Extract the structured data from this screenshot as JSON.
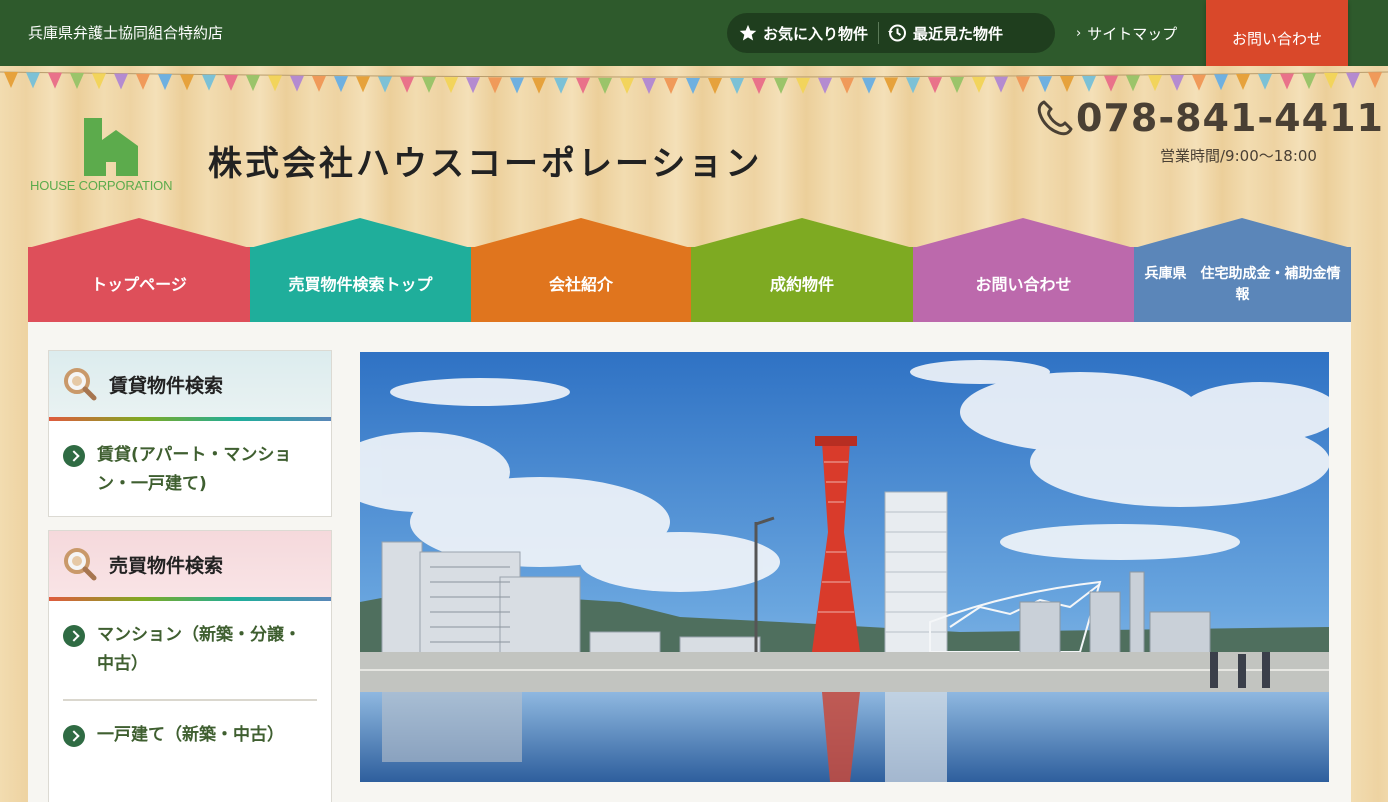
{
  "topbar": {
    "tagline": "兵庫県弁護士協同組合特約店",
    "favorites_label": "お気に入り物件",
    "recent_label": "最近見た物件",
    "sitemap_label": "サイトマップ",
    "contact_label": "お問い合わせ"
  },
  "header": {
    "logo_text": "HOUSE CORPORATION",
    "company_name": "株式会社ハウスコーポレーション",
    "phone": "078-841-4411",
    "hours": "営業時間/9:00〜18:00"
  },
  "nav": [
    {
      "label": "トップページ",
      "color": "#de4f5a"
    },
    {
      "label": "売買物件検索トップ",
      "color": "#1fae9b"
    },
    {
      "label": "会社紹介",
      "color": "#e0751e"
    },
    {
      "label": "成約物件",
      "color": "#7eaa22"
    },
    {
      "label": "お問い合わせ",
      "color": "#bc69ac"
    },
    {
      "label": "兵庫県　住宅助成金・補助金情報",
      "color": "#5b86b9"
    }
  ],
  "sidebar": {
    "rental": {
      "title": "賃貸物件検索",
      "links": [
        "賃貸(アパート・マンション・一戸建て)"
      ]
    },
    "sale": {
      "title": "売買物件検索",
      "links": [
        "マンション（新築・分譲・中古）",
        "一戸建て（新築・中古）"
      ]
    }
  },
  "colors": {
    "topbar": "#2e5a2c",
    "accent_red": "#d9482a",
    "logo_green": "#5cab4c"
  }
}
